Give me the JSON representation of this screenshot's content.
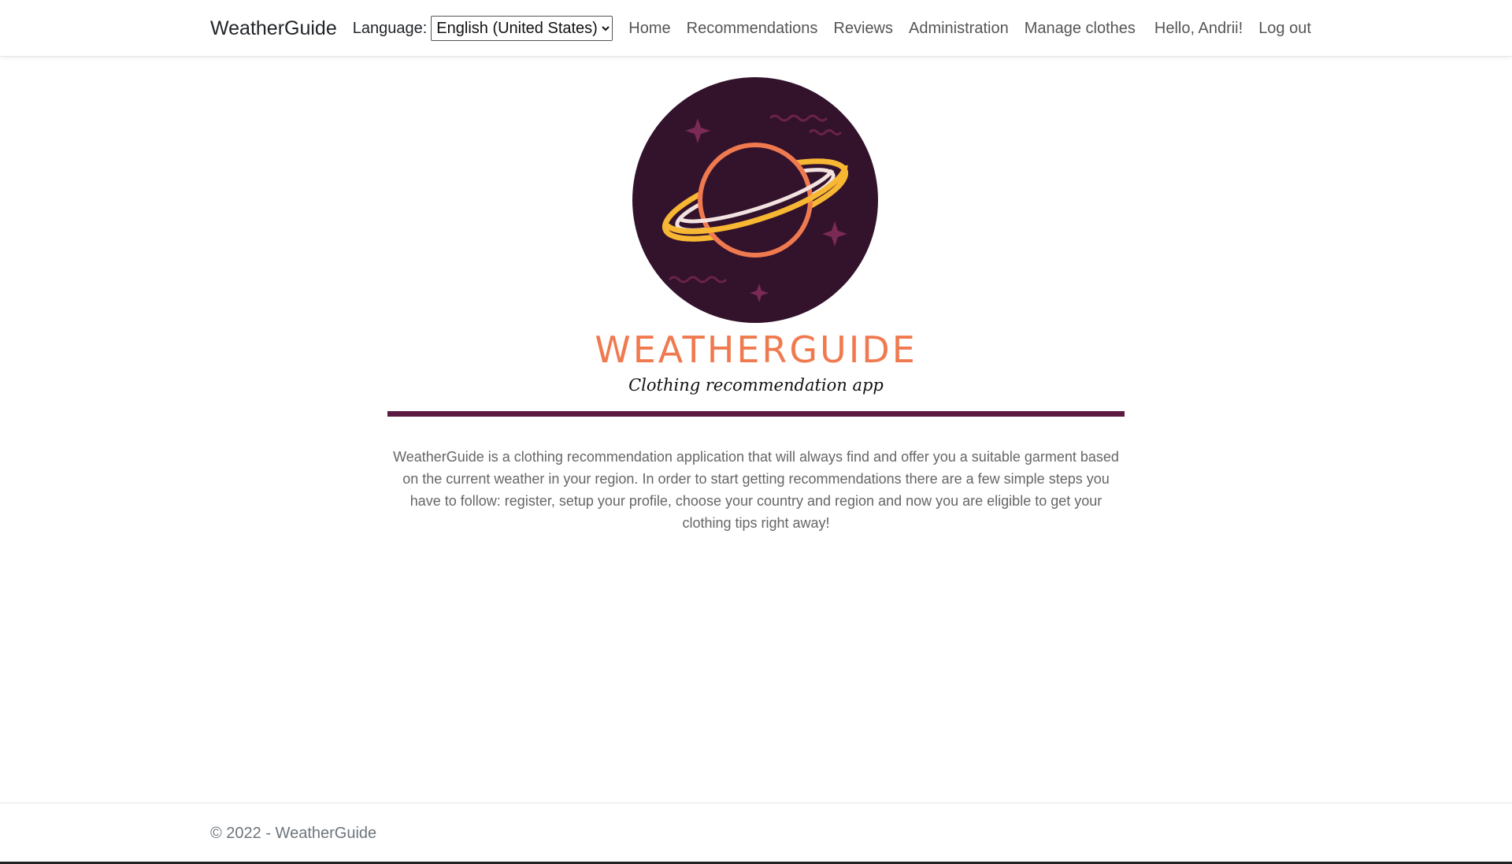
{
  "navbar": {
    "brand": "WeatherGuide",
    "language_label": "Language:",
    "language_selected": "English (United States)",
    "links": [
      "Home",
      "Recommendations",
      "Reviews",
      "Administration",
      "Manage clothes"
    ],
    "greeting": "Hello, Andrii!",
    "logout": "Log out"
  },
  "hero": {
    "title": "WEATHERGUIDE",
    "subtitle": "Clothing recommendation app",
    "description": "WeatherGuide is a clothing recommendation application that will always find and offer you a suitable garment based on the current weather in your region. In order to start getting recommendations there are a few simple steps you have to follow: register, setup your profile, choose your country and region and now you are eligible to get your clothing tips right away!"
  },
  "footer": {
    "text": "© 2022 - WeatherGuide"
  },
  "colors": {
    "accent": "#f07a4f",
    "logo_bg": "#33122c",
    "divider": "#5b1a3f"
  },
  "icons": {
    "logo": "planet-logo-icon"
  }
}
